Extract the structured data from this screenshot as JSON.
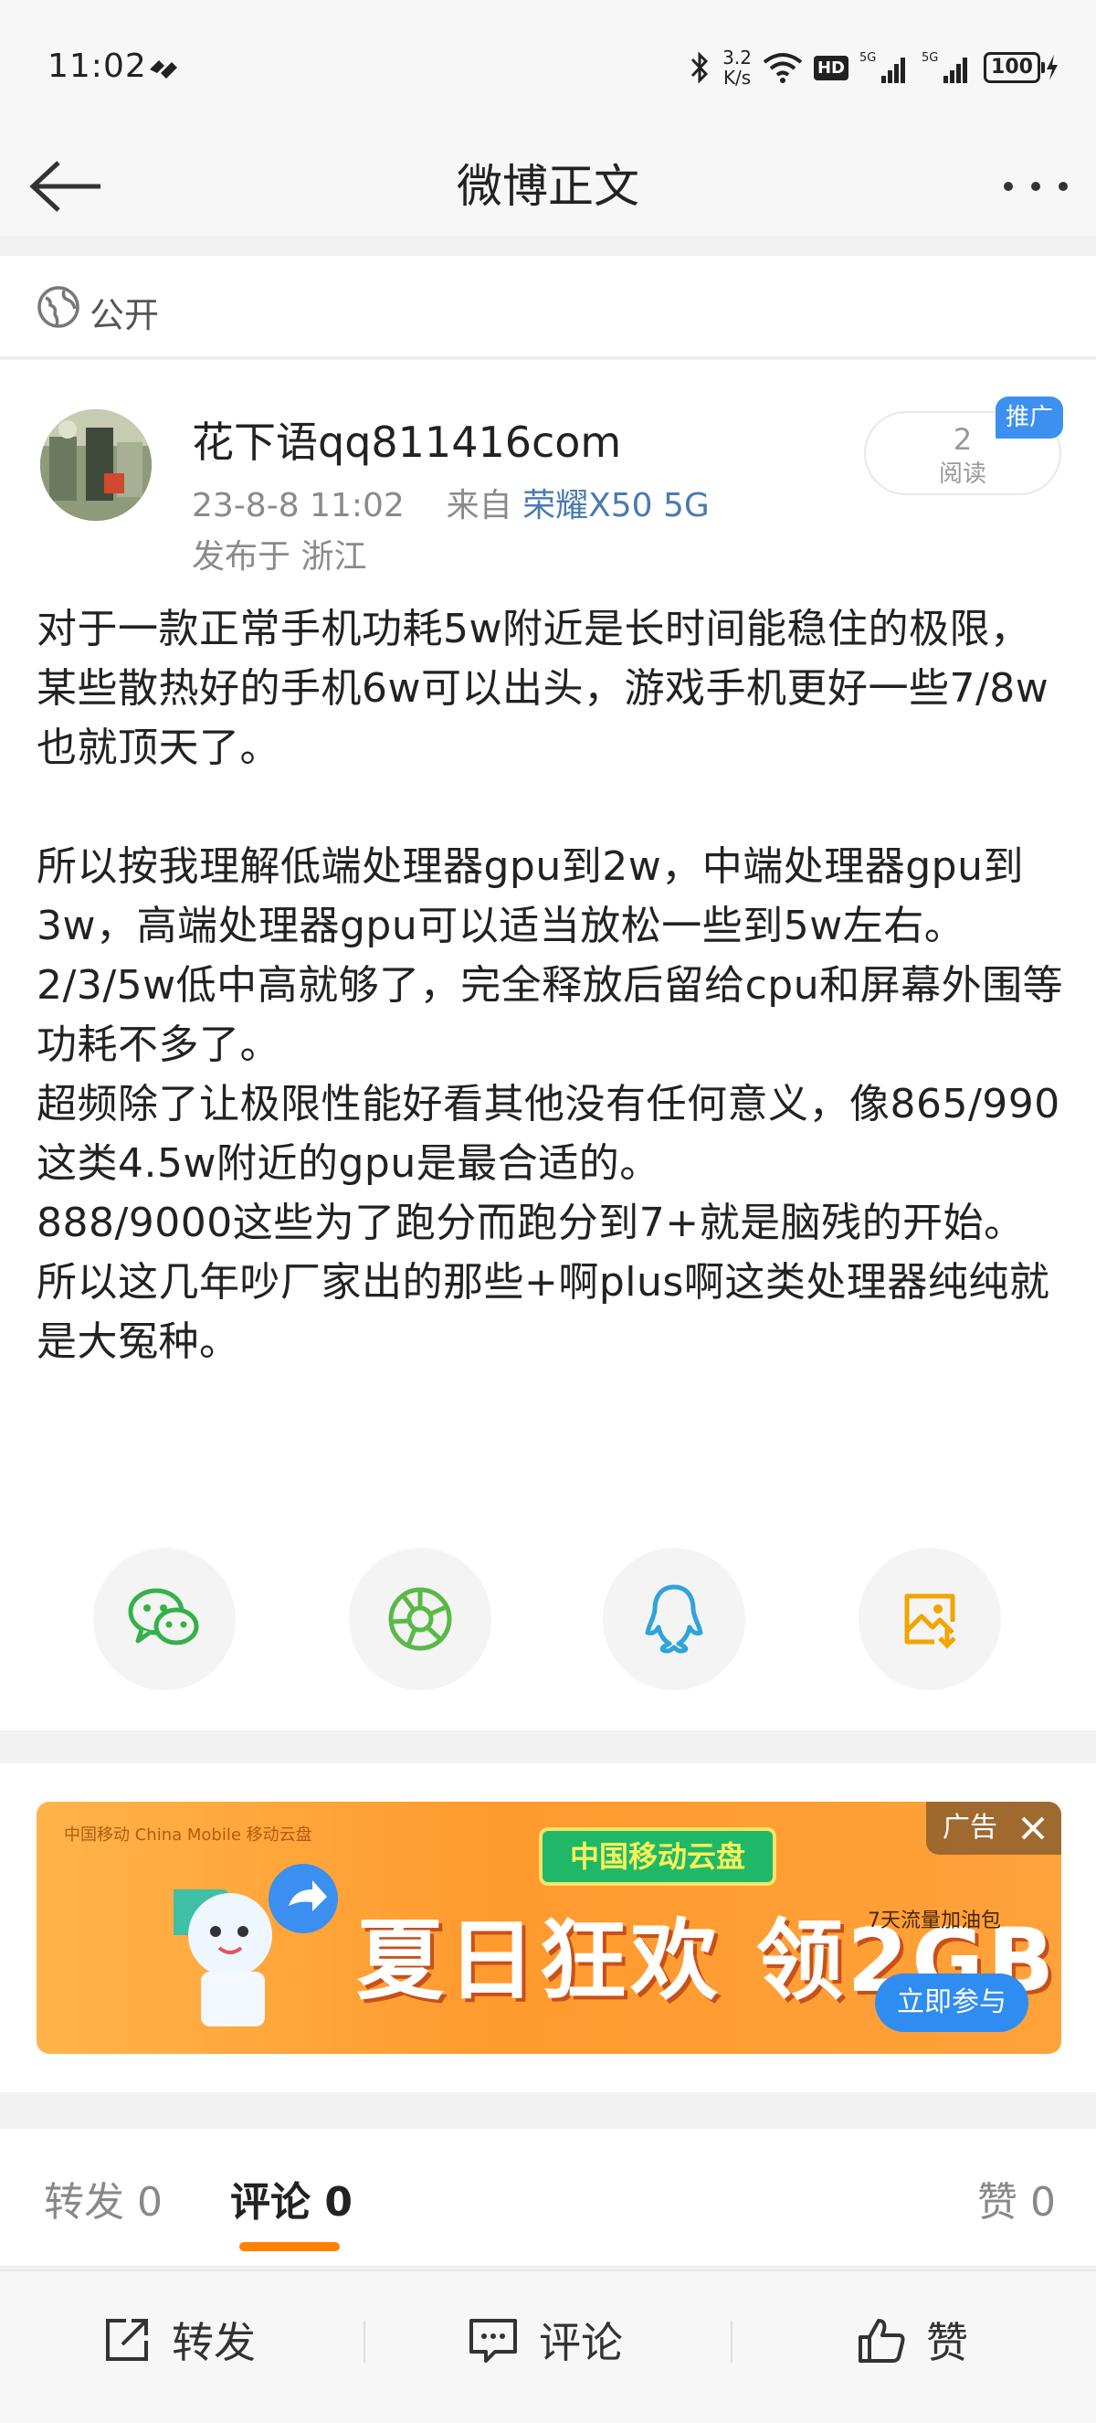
{
  "status_bar": {
    "time": "11:02",
    "net_speed_value": "3.2",
    "net_speed_unit": "K/s",
    "hd": "HD",
    "signal1": "5G",
    "signal2": "5G",
    "battery": "100"
  },
  "nav": {
    "title": "微博正文"
  },
  "visibility": {
    "label": "公开"
  },
  "post": {
    "author": "花下语qq811416com",
    "time": "23-8-8 11:02",
    "source_prefix": "来自",
    "device": "荣耀X50 5G",
    "location": "发布于 浙江",
    "read_count": "2",
    "read_label": "阅读",
    "promo_tag": "推广",
    "text": "对于一款正常手机功耗5w附近是长时间能稳住的极限，某些散热好的手机6w可以出头，游戏手机更好一些7/8w也就顶天了。\n\n所以按我理解低端处理器gpu到2w，中端处理器gpu到3w，高端处理器gpu可以适当放松一些到5w左右。\n2/3/5w低中高就够了，完全释放后留给cpu和屏幕外围等功耗不多了。\n超频除了让极限性能好看其他没有任何意义，像865/990这类4.5w附近的gpu是最合适的。\n888/9000这些为了跑分而跑分到7+就是脑残的开始。\n所以这几年吵厂家出的那些+啊plus啊这类处理器纯纯就是大冤种。"
  },
  "share": {
    "icons": [
      "wechat-icon",
      "moments-icon",
      "qq-icon",
      "save-image-icon"
    ]
  },
  "ad": {
    "corner_brand": "中国移动 China Mobile 移动云盘",
    "brand_box": "中国移动云盘",
    "slogan": "夏日狂欢 领2GB",
    "sub": "7天流量加油包",
    "cta": "立即参与",
    "label": "广告"
  },
  "tabs": {
    "repost": "转发 0",
    "comment": "评论 0",
    "like": "赞 0"
  },
  "actions": {
    "repost": "转发",
    "comment": "评论",
    "like": "赞"
  }
}
